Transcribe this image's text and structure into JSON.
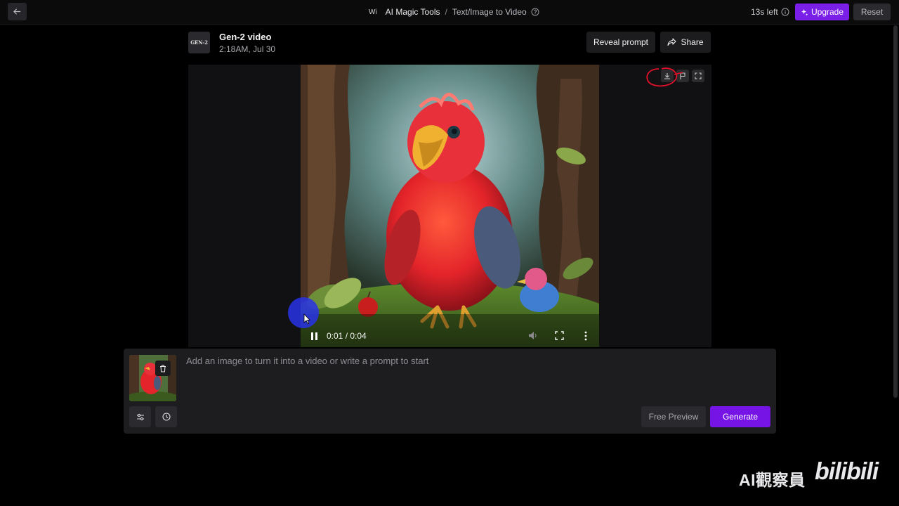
{
  "topbar": {
    "workspace": "Wi",
    "breadcrumb": [
      "AI Magic Tools",
      "Text/Image to Video"
    ],
    "time_left": "13s left",
    "upgrade_label": "Upgrade",
    "reset_label": "Reset"
  },
  "header": {
    "logo_text": "GEN-2",
    "title": "Gen-2 video",
    "timestamp": "2:18AM, Jul 30",
    "reveal_prompt_label": "Reveal prompt",
    "share_label": "Share"
  },
  "player": {
    "time": "0:01 / 0:04",
    "state": "playing",
    "progress_fraction": 0.25
  },
  "prompt_panel": {
    "placeholder": "Add an image to turn it into a video or write a prompt to start",
    "free_preview_label": "Free Preview",
    "generate_label": "Generate"
  },
  "watermark": {
    "text": "AI觀察員",
    "logo": "bilibili"
  },
  "colors": {
    "accent": "#7a1fe8",
    "background": "#000000",
    "panel": "#1d1d20",
    "annotation": "#e0102a"
  },
  "icons": [
    "arrow-left-icon",
    "help-icon",
    "info-icon",
    "sparkle-icon",
    "share-icon",
    "download-icon",
    "flag-icon",
    "expand-icon",
    "pause-icon",
    "volume-icon",
    "fullscreen-icon",
    "more-vertical-icon",
    "trash-icon",
    "settings-sliders-icon",
    "clock-icon"
  ]
}
